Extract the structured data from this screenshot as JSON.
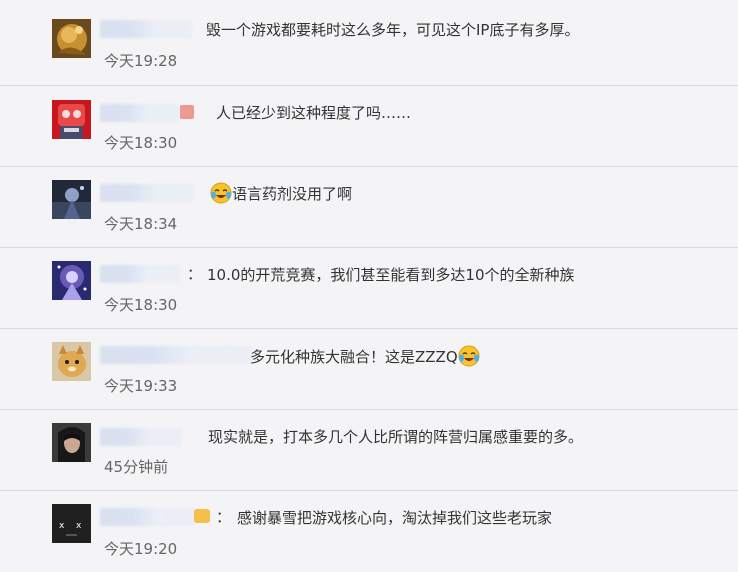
{
  "comments": [
    {
      "content": "毁一个游戏都要耗时这么多年，可见这个IP底子有多厚。",
      "time": "今天19:28"
    },
    {
      "content": "人已经少到这种程度了吗……",
      "time": "今天18:30"
    },
    {
      "content": "语言药剂没用了啊",
      "time": "今天18:34"
    },
    {
      "separator": "：",
      "content": "10.0的开荒竞赛，我们甚至能看到多达10个的全新种族",
      "time": "今天18:30"
    },
    {
      "content": "多元化种族大融合！这是ZZZQ",
      "time": "今天19:33"
    },
    {
      "content": "现实就是，打本多几个人比所谓的阵营归属感重要的多。",
      "time": "45分钟前"
    },
    {
      "separator": "：",
      "content": "感谢暴雪把游戏核心向，淘汰掉我们这些老玩家",
      "time": "今天19:20"
    }
  ],
  "icons": {
    "emoji": "laugh-cry-emoji-icon"
  },
  "colors": {
    "background": "#f4f4f6",
    "divider": "#dadade",
    "text": "#333333",
    "time": "#666666"
  }
}
